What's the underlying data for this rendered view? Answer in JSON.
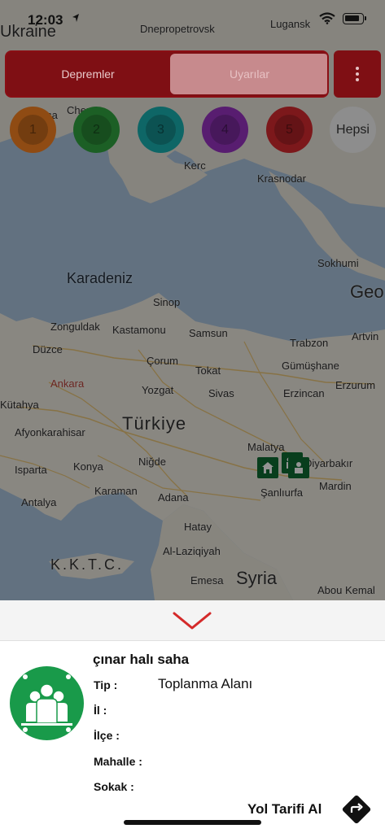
{
  "status_bar": {
    "time": "12:03"
  },
  "segment": {
    "earthquakes_label": "Depremler",
    "alerts_label": "Uyarılar"
  },
  "magnitude_filters": [
    {
      "label": "1",
      "color": "#e6791f"
    },
    {
      "label": "2",
      "color": "#2d9a3c"
    },
    {
      "label": "3",
      "color": "#17a4a4"
    },
    {
      "label": "4",
      "color": "#8e2fb5"
    },
    {
      "label": "5",
      "color": "#c8262c"
    }
  ],
  "all_filter_label": "Hepsi",
  "map_labels": {
    "ukraine": "Ukraine",
    "dnepropetrovsk": "Dnepropetrovsk",
    "lugansk": "Lugansk",
    "odessa": "Odessa",
    "cherson": "Cherson",
    "kerc": "Kerc",
    "krasnodar": "Krasnodar",
    "sokhumi": "Sokhumi",
    "georgia": "Geo",
    "karadeniz": "Karadeniz",
    "sinop": "Sinop",
    "zonguldak": "Zonguldak",
    "kastamonu": "Kastamonu",
    "samsun": "Samsun",
    "trabzon": "Trabzon",
    "artvin": "Artvin",
    "duzce": "Düzce",
    "corum": "Çorum",
    "gumushane": "Gümüşhane",
    "ankara": "Ankara",
    "tokat": "Tokat",
    "erzurum": "Erzurum",
    "yozgat": "Yozgat",
    "sivas": "Sivas",
    "erzincan": "Erzincan",
    "kutahya": "Kütahya",
    "afyon": "Afyonkarahisar",
    "turkiye": "Türkiye",
    "nigde": "Niğde",
    "malatya": "Malatya",
    "diyarbakir": "Diyarbakır",
    "isparta": "Isparta",
    "konya": "Konya",
    "karaman": "Karaman",
    "adana": "Adana",
    "sanliurfa": "Şanlıurfa",
    "mardin": "Mardin",
    "antalya": "Antalya",
    "hatay": "Hatay",
    "kktc": "K.K.T.C.",
    "al_laziqiyah": "Al-Laziqiyah",
    "emesa": "Emesa",
    "syria": "Syria",
    "abou_kemal": "Abou Kemal"
  },
  "place": {
    "name": "çınar halı saha",
    "type_label": "Tip :",
    "type_value": "Toplanma Alanı",
    "province_label": "İl :",
    "district_label": "İlçe :",
    "neighborhood_label": "Mahalle :",
    "street_label": "Sokak :"
  },
  "directions_label": "Yol Tarifi Al",
  "colors": {
    "brand_red": "#7f0f14",
    "assembly_green": "#199a4a",
    "collapse_arrow": "#d42a2a"
  }
}
